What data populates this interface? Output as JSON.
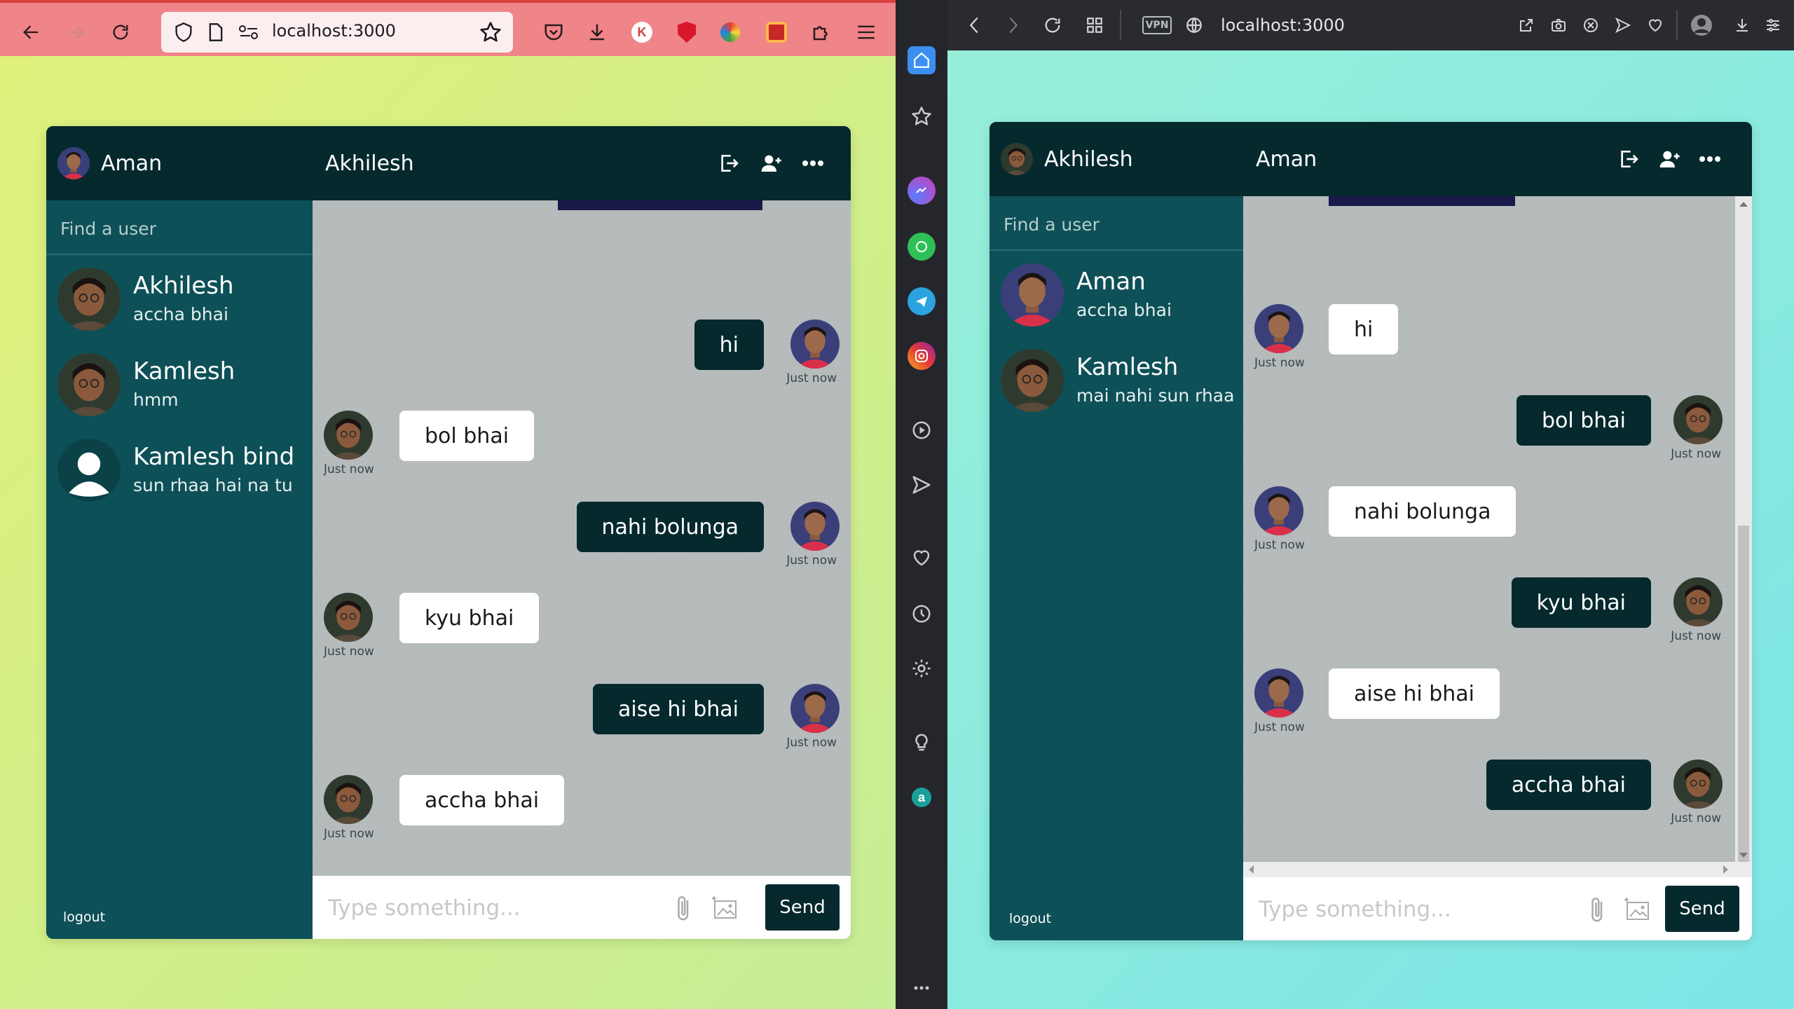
{
  "left_browser": {
    "url": "localhost:3000"
  },
  "right_browser": {
    "url": "localhost:3000",
    "vpn_label": "VPN"
  },
  "left_chat": {
    "current_user": "Aman",
    "partner_name": "Akhilesh",
    "search_placeholder": "Find a user",
    "users": [
      {
        "name": "Akhilesh",
        "last_message": "accha bhai"
      },
      {
        "name": "Kamlesh",
        "last_message": "hmm"
      },
      {
        "name": "Kamlesh bind",
        "last_message": "sun rhaa hai na tu"
      }
    ],
    "messages": [
      {
        "text": "hi",
        "direction": "out",
        "time": "Just now"
      },
      {
        "text": "bol bhai",
        "direction": "in",
        "time": "Just now"
      },
      {
        "text": "nahi bolunga",
        "direction": "out",
        "time": "Just now"
      },
      {
        "text": "kyu bhai",
        "direction": "in",
        "time": "Just now"
      },
      {
        "text": "aise hi bhai",
        "direction": "out",
        "time": "Just now"
      },
      {
        "text": "accha bhai",
        "direction": "in",
        "time": "Just now"
      }
    ],
    "input_placeholder": "Type something...",
    "send_label": "Send",
    "logout_label": "logout"
  },
  "right_chat": {
    "current_user": "Akhilesh",
    "partner_name": "Aman",
    "search_placeholder": "Find a user",
    "users": [
      {
        "name": "Aman",
        "last_message": "accha bhai"
      },
      {
        "name": "Kamlesh",
        "last_message": "mai nahi sun rhaa"
      }
    ],
    "messages": [
      {
        "text": "hi",
        "direction": "in",
        "time": "Just now"
      },
      {
        "text": "bol bhai",
        "direction": "out",
        "time": "Just now"
      },
      {
        "text": "nahi bolunga",
        "direction": "in",
        "time": "Just now"
      },
      {
        "text": "kyu bhai",
        "direction": "out",
        "time": "Just now"
      },
      {
        "text": "aise hi bhai",
        "direction": "in",
        "time": "Just now"
      },
      {
        "text": "accha bhai",
        "direction": "out",
        "time": "Just now"
      }
    ],
    "input_placeholder": "Type something...",
    "send_label": "Send",
    "logout_label": "logout"
  },
  "colors": {
    "sidebar": "#0e5057",
    "header": "#05292d",
    "message_area": "#b5babb",
    "bubble_in": "#ffffff",
    "bubble_out": "#05292d",
    "firefox_toolbar": "#ef8489",
    "opera_toolbar": "#2a2b31"
  }
}
